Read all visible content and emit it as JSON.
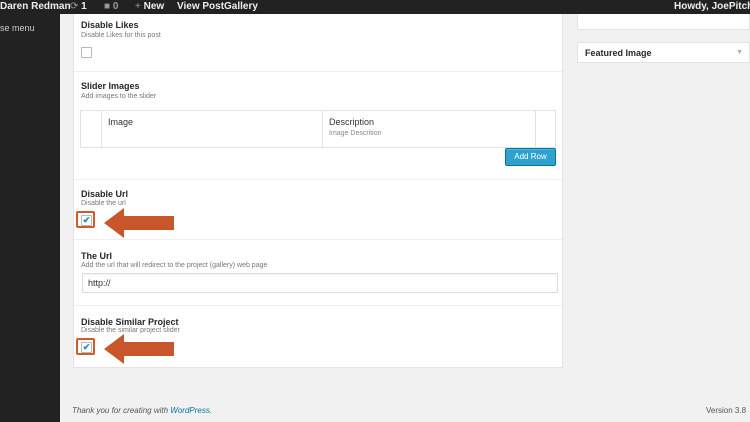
{
  "adminbar": {
    "site_name": "Daren Redman",
    "updates_count": "1",
    "comments_count": "0",
    "new_label": "New",
    "view_post_label": "View Post",
    "gallery_label": "Gallery",
    "howdy": "Howdy, JoePitcher"
  },
  "leftmenu": {
    "collapse_label": "se menu"
  },
  "fields": {
    "disable_likes": {
      "label": "Disable Likes",
      "desc": "Disable Likes for this post",
      "checked": false
    },
    "slider_images": {
      "label": "Slider Images",
      "desc": "Add images to the slider",
      "columns": [
        {
          "label": "Image",
          "sub": ""
        },
        {
          "label": "Description",
          "sub": "Image Descrition"
        }
      ],
      "add_row_label": "Add Row"
    },
    "disable_url": {
      "label": "Disable Url",
      "desc": "Disable the url",
      "checked": true,
      "check_glyph": "✔"
    },
    "the_url": {
      "label": "The Url",
      "desc": "Add the url that will redirect to the project (gallery) web page",
      "value": "http://"
    },
    "disable_similar": {
      "label": "Disable Similar Project",
      "desc": "Disable the similar project slider",
      "checked": true,
      "check_glyph": "✔"
    }
  },
  "sidebar": {
    "featured_image_title": "Featured Image",
    "toggle_icon": "▼"
  },
  "footer": {
    "thanks_prefix": "Thank you for creating with ",
    "wp_link": "WordPress",
    "thanks_suffix": ".",
    "version": "Version 3.8"
  },
  "colors": {
    "annotation": "#c8562a",
    "button": "#2ea2cc",
    "adminbar": "#222222"
  }
}
